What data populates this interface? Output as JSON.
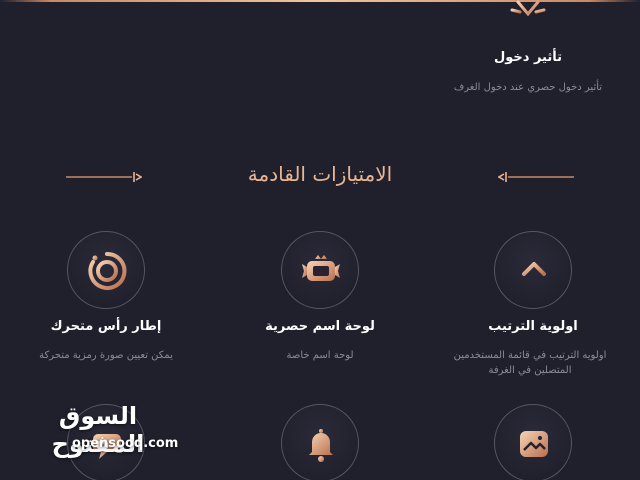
{
  "colors": {
    "background": "#20202d",
    "accent": "#e9b592",
    "accent_dark": "#b06d4e",
    "title": "#ffffff",
    "description": "#8d8b98"
  },
  "top_feature": {
    "icon": "entrance-effect-icon",
    "title": "تأثير دخول",
    "description": "تأثير دخول حصري عند دخول الغرف"
  },
  "section": {
    "title": "الامتيازات القادمة"
  },
  "features": [
    {
      "icon": "ranking-priority-icon",
      "title": "اولوية الترتيب",
      "description_line1": "اولويه الترتيب في قائمة المستخدمين",
      "description_line2": "المتصلين في الغرفة"
    },
    {
      "icon": "nameplate-icon",
      "title": "لوحة اسم حصرية",
      "description_line1": "لوحة اسم خاصة"
    },
    {
      "icon": "avatar-frame-icon",
      "title": "إطار رأس متحرك",
      "description_line1": "يمكن تعيين صورة رمزية متحركة"
    }
  ],
  "bottom_row_icons": [
    "image-icon",
    "bell-icon",
    "chat-icon"
  ],
  "watermark": {
    "arabic": "السوق المفتوح",
    "latin": "opensooq.com"
  }
}
